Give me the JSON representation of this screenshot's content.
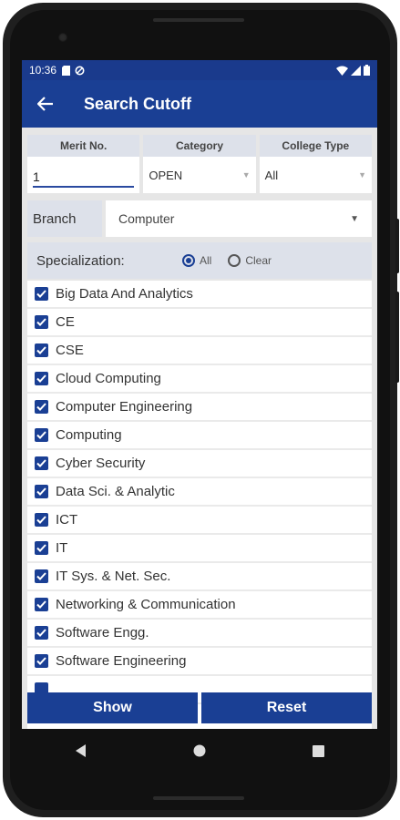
{
  "status": {
    "time": "10:36"
  },
  "appbar": {
    "title": "Search Cutoff"
  },
  "filters": {
    "merit": {
      "label": "Merit No.",
      "value": "1"
    },
    "category": {
      "label": "Category",
      "value": "OPEN"
    },
    "college_type": {
      "label": "College Type",
      "value": "All"
    }
  },
  "branch": {
    "label": "Branch",
    "value": "Computer"
  },
  "specialization": {
    "label": "Specialization:",
    "all_label": "All",
    "clear_label": "Clear"
  },
  "items": [
    "Big Data And Analytics",
    "CE",
    "CSE",
    "Cloud Computing",
    "Computer Engineering",
    "Computing",
    "Cyber Security",
    "Data Sci. & Analytic",
    "ICT",
    "IT",
    "IT Sys. & Net. Sec.",
    "Networking & Communication",
    "Software Engg.",
    "Software Engineering"
  ],
  "buttons": {
    "show": "Show",
    "reset": "Reset"
  },
  "colors": {
    "primary": "#1a3f94",
    "header_bg": "#dde1ea"
  }
}
